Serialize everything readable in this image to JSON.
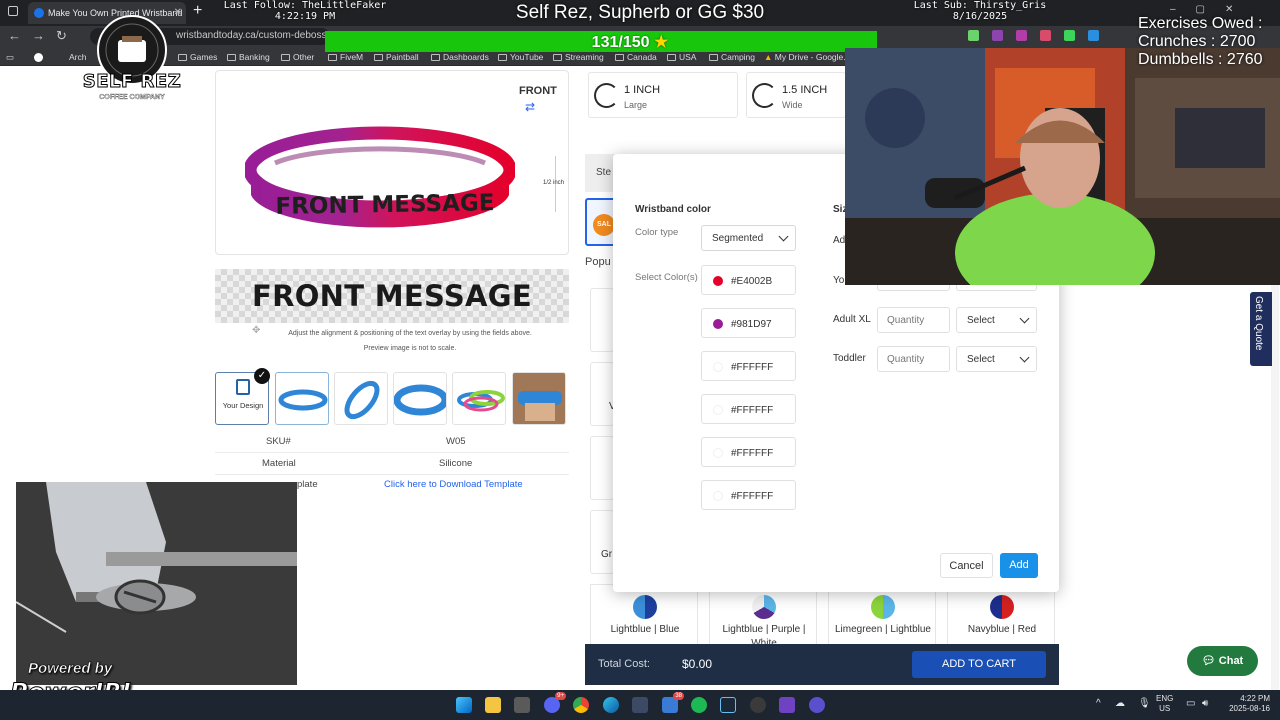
{
  "browser": {
    "tab_title": "Make You Own Printed Wristband",
    "url": "wristbandtoday.ca/custom-debosse",
    "bookmarks": [
      "Arch",
      "Games",
      "Banking",
      "Other",
      "FiveM",
      "Paintball",
      "Dashboards",
      "YouTube",
      "Streaming",
      "Canada",
      "USA",
      "Camping",
      "My Drive - Google..."
    ]
  },
  "overlay": {
    "last_follow_label": "Last Follow: TheLittleFaker",
    "last_follow_time": "4:22:19 PM",
    "offer": "Self Rez, Supherb or GG $30",
    "goal": "131/150",
    "goal_icon": "star-icon",
    "last_sub_label": "Last Sub: Thirsty_Gris",
    "last_sub_date": "8/16/2025",
    "exercises_title": "Exercises Owed :",
    "crunches": "Crunches : 2700",
    "dumbbells": "Dumbbells : 2760",
    "logo_name": "SELF REZ",
    "logo_sub": "COFFEE COMPANY",
    "logo_est": "EST. 2024",
    "powered_by": "Powered by",
    "powerirl": "PowerIRL"
  },
  "product": {
    "front_label": "FRONT",
    "dimension": "1/2 inch",
    "band_message": "FRONT MESSAGE",
    "preview_message": "FRONT MESSAGE",
    "adjust_note": "Adjust the alignment & positioning of the text overlay by using the fields above.",
    "scale_note": "Preview image is not to scale.",
    "your_design": "Your Design",
    "sku_label": "SKU#",
    "sku_value": "W05",
    "material_label": "Material",
    "material_value": "Silicone",
    "template_label": "plate",
    "download_link": "Click here to Download Template"
  },
  "options": {
    "sizes": [
      {
        "title": "1 INCH",
        "sub": "Large"
      },
      {
        "title": "1.5 INCH",
        "sub": "Wide"
      }
    ],
    "step_label": "Ste",
    "sale_label": "SAL",
    "popular_label": "Popu",
    "partial_labels": [
      "V",
      "Gr"
    ],
    "swatches": [
      {
        "label": "Lightblue | Blue",
        "c1": "#3b8fd9",
        "c2": "#1d3f9e"
      },
      {
        "label": "Lightblue | Purple | White",
        "c1": "#3b8fd9",
        "c2": "#5b2d8e"
      },
      {
        "label": "Limegreen | Lightblue",
        "c1": "#8cd43c",
        "c2": "#5bb6e8"
      },
      {
        "label": "Navyblue | Red",
        "c1": "#1d2e8e",
        "c2": "#d62020"
      }
    ]
  },
  "modal": {
    "title": "Wristband color",
    "color_type_label": "Color type",
    "color_type_value": "Segmented",
    "select_colors_label": "Select Color(s)",
    "colors": [
      "#E4002B",
      "#981D97",
      "#FFFFFF",
      "#FFFFFF",
      "#FFFFFF",
      "#FFFFFF"
    ],
    "size_head": "Siz",
    "rows": [
      {
        "label": "Ad",
        "qty": "",
        "select": ""
      },
      {
        "label": "Yo",
        "qty": "",
        "select": ""
      },
      {
        "label": "Adult XL",
        "qty": "Quantity",
        "select": "Select"
      },
      {
        "label": "Toddler",
        "qty": "Quantity",
        "select": "Select"
      }
    ],
    "cancel": "Cancel",
    "add": "Add"
  },
  "cart": {
    "total_label": "Total Cost:",
    "total_value": "$0.00",
    "add_to_cart": "ADD TO CART"
  },
  "side": {
    "quote_tab": "Get a Quote",
    "chat": "Chat"
  },
  "taskbar": {
    "lang1": "ENG",
    "lang2": "US",
    "time": "4:22 PM",
    "date": "2025-08-16",
    "badge_discord": "9+",
    "badge_app": "38"
  },
  "colors": {
    "accent_blue": "#1a91e8",
    "goal_green": "#18c60c",
    "cart_navy": "#1f2e45",
    "band_red": "#E4002B",
    "band_purple": "#981D97"
  }
}
